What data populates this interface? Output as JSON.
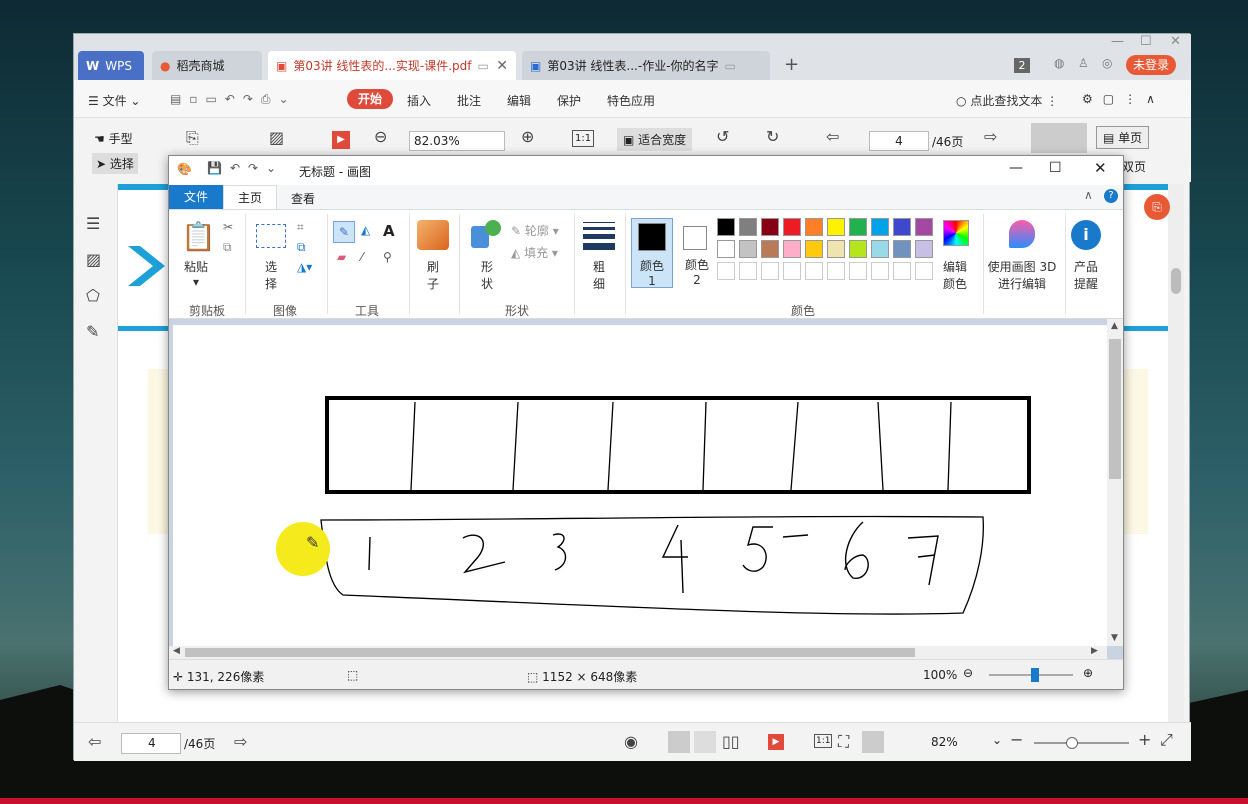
{
  "wps": {
    "tabs": [
      "WPS",
      "稻壳商城",
      "第03讲 线性表的...实现-课件.pdf",
      "第03讲 线性表...-作业-你的名字"
    ],
    "tab_badge": "2",
    "login": "未登录",
    "menu": {
      "file": "文件",
      "items": [
        "开始",
        "插入",
        "批注",
        "编辑",
        "保护",
        "特色应用"
      ],
      "search": "点此查找文本"
    },
    "toolbar": {
      "hand": "手型",
      "select": "选择",
      "zoom": "82.03%",
      "fit_width": "适合宽度",
      "page": "4",
      "page_total": "/46页",
      "single_page": "单页",
      "double_page": "双页"
    },
    "status": {
      "page": "4",
      "page_total": "/46页",
      "zoom": "82%"
    }
  },
  "paint": {
    "title": "无标题 - 画图",
    "tabs": {
      "file": "文件",
      "home": "主页",
      "view": "查看"
    },
    "ribbon": {
      "paste": "粘贴",
      "select": "选择",
      "brush": "刷子",
      "shapes": "形状",
      "outline": "轮廓",
      "fill": "填充",
      "size": "粗细",
      "color1": "颜色 1",
      "color2": "颜色 2",
      "edit_colors": "编辑颜色",
      "paint3d": "使用画图 3D 进行编辑",
      "product_alert": "产品提醒",
      "groups": [
        "剪贴板",
        "图像",
        "工具",
        "形状",
        "颜色"
      ]
    },
    "palette": [
      "#000000",
      "#7f7f7f",
      "#880015",
      "#ed1c24",
      "#ff7f27",
      "#fff200",
      "#22b14c",
      "#00a2e8",
      "#3f48cc",
      "#a349a4",
      "#ffffff",
      "#c3c3c3",
      "#b97a57",
      "#ffaec9",
      "#ffc90e",
      "#efe4b0",
      "#b5e61d",
      "#99d9ea",
      "#7092be",
      "#c8bfe7"
    ],
    "status": {
      "cursor": "131, 226像素",
      "size": "1152 × 648像素",
      "zoom": "100%"
    },
    "zoom_level": 0.55
  }
}
